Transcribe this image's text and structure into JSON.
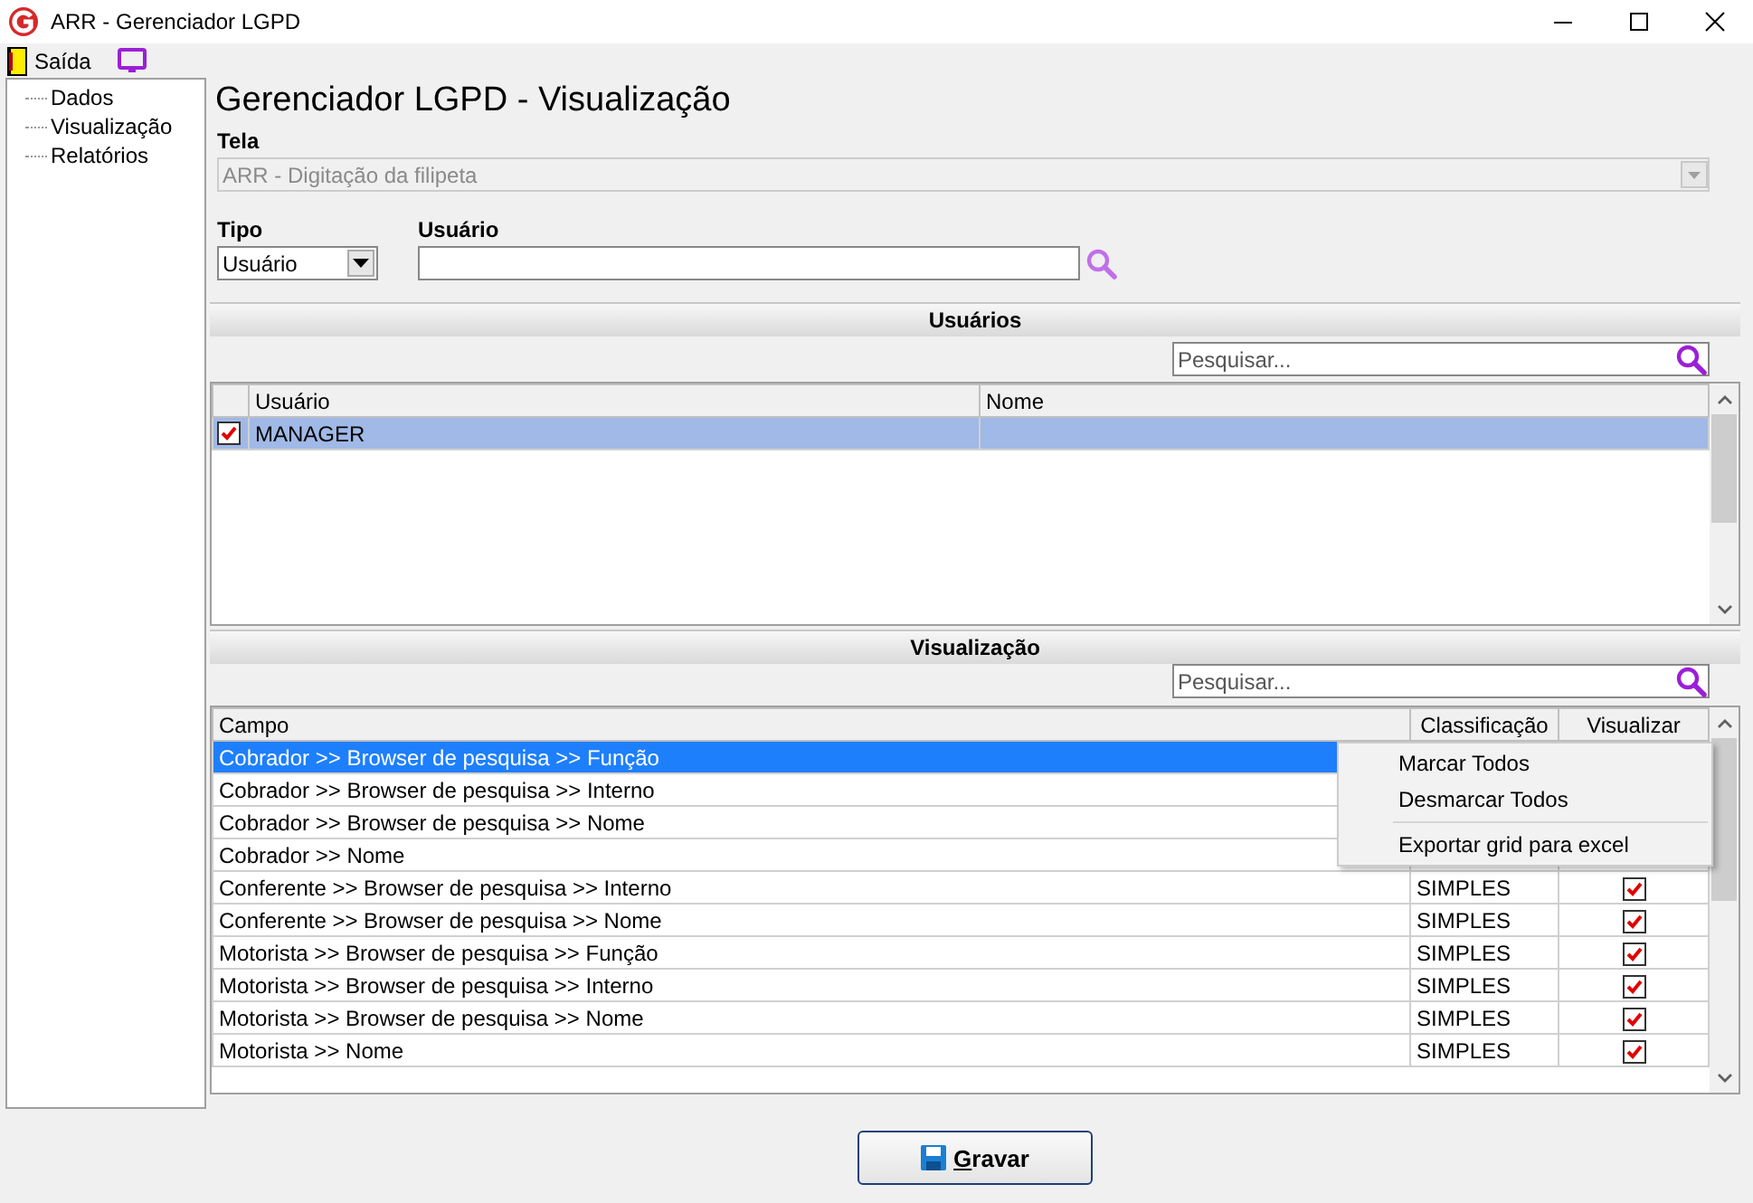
{
  "window": {
    "title": "ARR - Gerenciador LGPD"
  },
  "toolbar": [
    {
      "label": "Saída"
    }
  ],
  "sidebar": {
    "items": [
      {
        "label": "Dados"
      },
      {
        "label": "Visualização"
      },
      {
        "label": "Relatórios"
      }
    ]
  },
  "page_title": "Gerenciador LGPD - Visualização",
  "tela": {
    "label": "Tela",
    "value": "ARR - Digitação da filipeta",
    "disabled": true
  },
  "tipo": {
    "label": "Tipo",
    "value": "Usuário"
  },
  "usuario": {
    "label": "Usuário"
  },
  "usuarios": {
    "title": "Usuários",
    "search_placeholder": "Pesquisar...",
    "columns": [
      "Usuário",
      "Nome"
    ],
    "rows": [
      {
        "usuario": "MANAGER",
        "checked": true,
        "selected": true
      }
    ]
  },
  "visualizacao": {
    "title": "Visualização",
    "search_placeholder": "Pesquisar...",
    "columns": [
      "Campo",
      "Classificação",
      "Visualizar"
    ],
    "rows": [
      {
        "campo": "Cobrador >> Browser de pesquisa >> Função",
        "selected": true
      },
      {
        "campo": "Cobrador >> Browser de pesquisa >> Interno",
        "selected": false
      },
      {
        "campo": "Cobrador >> Browser de pesquisa >> Nome",
        "selected": false
      },
      {
        "campo": "Cobrador >> Nome",
        "selected": false
      },
      {
        "campo": "Conferente >> Browser de pesquisa >> Interno",
        "classificacao": "SIMPLES",
        "visualizar": true,
        "selected": false
      },
      {
        "campo": "Conferente >> Browser de pesquisa >> Nome",
        "classificacao": "SIMPLES",
        "visualizar": true,
        "selected": false
      },
      {
        "campo": "Motorista >> Browser de pesquisa >> Função",
        "classificacao": "SIMPLES",
        "visualizar": true,
        "selected": false
      },
      {
        "campo": "Motorista >> Browser de pesquisa >> Interno",
        "classificacao": "SIMPLES",
        "visualizar": true,
        "selected": false
      },
      {
        "campo": "Motorista >> Browser de pesquisa >> Nome",
        "classificacao": "SIMPLES",
        "visualizar": true,
        "selected": false
      },
      {
        "campo": "Motorista >> Nome",
        "classificacao": "SIMPLES",
        "visualizar": true,
        "selected": false
      }
    ]
  },
  "context_menu": [
    {
      "kind": "item",
      "label": "Marcar Todos"
    },
    {
      "kind": "item",
      "label": "Desmarcar Todos"
    },
    {
      "kind": "separator"
    },
    {
      "kind": "item",
      "label": "Exportar grid para excel"
    }
  ],
  "save_button": {
    "label": "Gravar"
  }
}
